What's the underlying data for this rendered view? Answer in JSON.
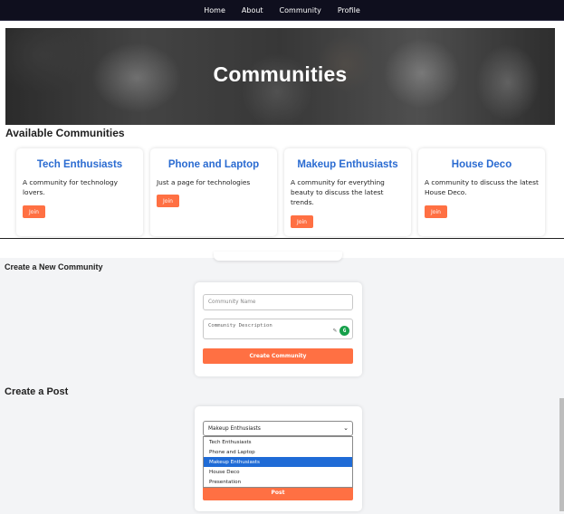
{
  "nav": {
    "links": [
      "Home",
      "About",
      "Community",
      "Profile"
    ]
  },
  "hero": {
    "title": "Communities"
  },
  "available": {
    "heading": "Available Communities",
    "join_label": "Join",
    "cards": [
      {
        "title": "Tech Enthusiasts",
        "description": "A community for technology lovers."
      },
      {
        "title": "Phone and Laptop",
        "description": "Just a page for technologies"
      },
      {
        "title": "Makeup Enthusiasts",
        "description": "A community for everything beauty to discuss the latest trends."
      },
      {
        "title": "House Deco",
        "description": "A community to discuss the latest House Deco."
      }
    ]
  },
  "create_community": {
    "heading": "Create a New Community",
    "name_placeholder": "Community Name",
    "description_placeholder": "Community Description",
    "grammar_badge": "G",
    "button_label": "Create Community"
  },
  "create_post": {
    "heading": "Create a Post",
    "selected_community": "Makeup Enthusiasts",
    "options": [
      "Tech Enthusiasts",
      "Phone and Laptop",
      "Makeup Enthusiasts",
      "House Deco",
      "Presentation"
    ],
    "button_label": "Post"
  },
  "colors": {
    "accent": "#ff7043",
    "title_blue": "#2a6bd1",
    "navbar": "#0f0f1e",
    "selection": "#1f6bd6"
  }
}
